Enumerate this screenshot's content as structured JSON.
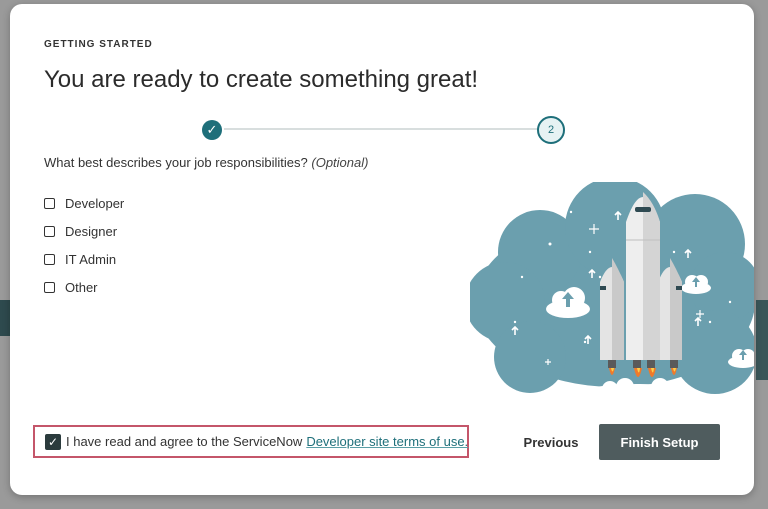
{
  "modal": {
    "eyebrow": "GETTING STARTED",
    "title": "You are ready to create something great!"
  },
  "stepper": {
    "step1_icon": "checkmark-icon",
    "step2_label": "2"
  },
  "question": {
    "text": "What best describes your job responsibilities?",
    "optional": "(Optional)"
  },
  "options": [
    {
      "label": "Developer",
      "checked": false
    },
    {
      "label": "Designer",
      "checked": false
    },
    {
      "label": "IT Admin",
      "checked": false
    },
    {
      "label": "Other",
      "checked": false
    }
  ],
  "terms": {
    "checked": true,
    "text": "I have read and agree to the ServiceNow",
    "link": "Developer site terms of use."
  },
  "footer": {
    "previous": "Previous",
    "finish": "Finish Setup"
  },
  "colors": {
    "accent": "#1e6f7a",
    "cloud": "#6b9fae",
    "finish_button": "#4f5c5e",
    "highlight_border": "#c4566a"
  }
}
